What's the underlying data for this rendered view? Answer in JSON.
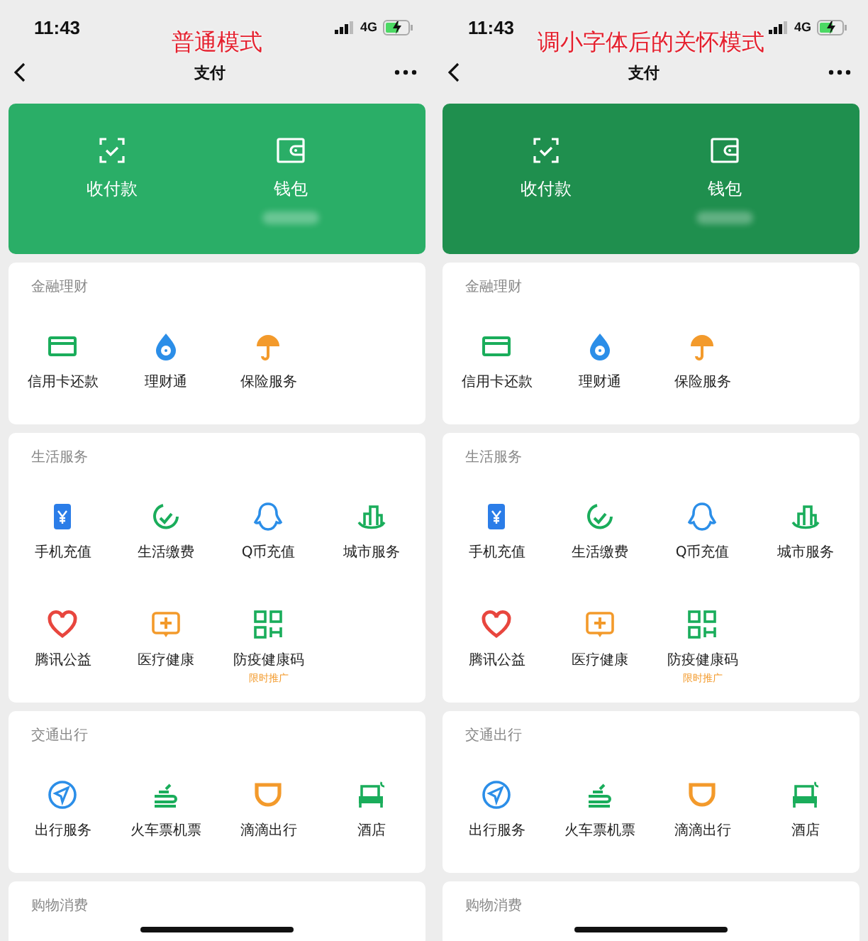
{
  "panels": [
    {
      "caption": "普通模式",
      "time": "11:43",
      "network": "4G",
      "title": "支付",
      "color": "#2aae67",
      "hero": [
        {
          "label": "收付款",
          "kind": "scan",
          "redacted": false
        },
        {
          "label": "钱包",
          "kind": "wallet",
          "redacted": true
        }
      ],
      "sections": [
        {
          "title": "金融理财",
          "items": [
            {
              "label": "信用卡还款",
              "kind": "card"
            },
            {
              "label": "理财通",
              "kind": "licai"
            },
            {
              "label": "保险服务",
              "kind": "insurance"
            }
          ]
        },
        {
          "title": "生活服务",
          "items": [
            {
              "label": "手机充值",
              "kind": "phone"
            },
            {
              "label": "生活缴费",
              "kind": "bill"
            },
            {
              "label": "Q币充值",
              "kind": "qq"
            },
            {
              "label": "城市服务",
              "kind": "city"
            },
            {
              "label": "腾讯公益",
              "kind": "heart"
            },
            {
              "label": "医疗健康",
              "kind": "medical"
            },
            {
              "label": "防疫健康码",
              "kind": "qr",
              "badge": "限时推广"
            }
          ]
        },
        {
          "title": "交通出行",
          "items": [
            {
              "label": "出行服务",
              "kind": "navigate"
            },
            {
              "label": "火车票机票",
              "kind": "train"
            },
            {
              "label": "滴滴出行",
              "kind": "didi"
            },
            {
              "label": "酒店",
              "kind": "hotel"
            }
          ]
        },
        {
          "title": "购物消费"
        }
      ]
    },
    {
      "caption": "调小字体后的关怀模式",
      "time": "11:43",
      "network": "4G",
      "title": "支付",
      "color": "#1f8f4e",
      "hero": [
        {
          "label": "收付款",
          "kind": "scan",
          "redacted": false
        },
        {
          "label": "钱包",
          "kind": "wallet",
          "redacted": true
        }
      ],
      "sections": [
        {
          "title": "金融理财",
          "items": [
            {
              "label": "信用卡还款",
              "kind": "card"
            },
            {
              "label": "理财通",
              "kind": "licai"
            },
            {
              "label": "保险服务",
              "kind": "insurance"
            }
          ]
        },
        {
          "title": "生活服务",
          "items": [
            {
              "label": "手机充值",
              "kind": "phone"
            },
            {
              "label": "生活缴费",
              "kind": "bill"
            },
            {
              "label": "Q币充值",
              "kind": "qq"
            },
            {
              "label": "城市服务",
              "kind": "city"
            },
            {
              "label": "腾讯公益",
              "kind": "heart"
            },
            {
              "label": "医疗健康",
              "kind": "medical"
            },
            {
              "label": "防疫健康码",
              "kind": "qr",
              "badge": "限时推广"
            }
          ]
        },
        {
          "title": "交通出行",
          "items": [
            {
              "label": "出行服务",
              "kind": "navigate"
            },
            {
              "label": "火车票机票",
              "kind": "train"
            },
            {
              "label": "滴滴出行",
              "kind": "didi"
            },
            {
              "label": "酒店",
              "kind": "hotel"
            }
          ]
        },
        {
          "title": "购物消费"
        }
      ]
    }
  ]
}
